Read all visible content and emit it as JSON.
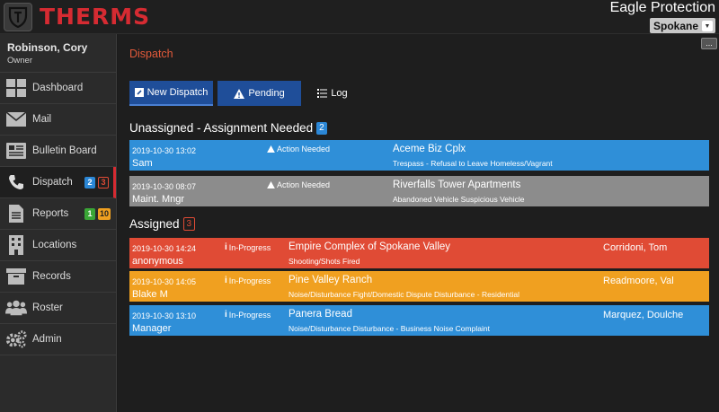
{
  "app": {
    "logo_text": "THERMS",
    "org_name": "Eagle Protection",
    "location": "Spokane"
  },
  "user": {
    "name": "Robinson, Cory",
    "role": "Owner"
  },
  "sidebar": {
    "items": [
      {
        "label": "Dashboard",
        "icon": "dashboard-icon"
      },
      {
        "label": "Mail",
        "icon": "mail-icon"
      },
      {
        "label": "Bulletin Board",
        "icon": "bulletin-board-icon"
      },
      {
        "label": "Dispatch",
        "icon": "phone-icon",
        "badges": [
          "2",
          "3"
        ]
      },
      {
        "label": "Reports",
        "icon": "document-icon",
        "badges": [
          "1",
          "10"
        ]
      },
      {
        "label": "Locations",
        "icon": "building-icon"
      },
      {
        "label": "Records",
        "icon": "archive-icon"
      },
      {
        "label": "Roster",
        "icon": "people-icon"
      },
      {
        "label": "Admin",
        "icon": "gears-icon"
      }
    ]
  },
  "main": {
    "title": "Dispatch",
    "more_label": "...",
    "buttons": {
      "new_dispatch": "New Dispatch",
      "pending": "Pending",
      "log": "Log"
    },
    "unassigned": {
      "title": "Unassigned - Assignment Needed",
      "count": "2",
      "rows": [
        {
          "datetime": "2019-10-30   13:02",
          "caller": "Sam",
          "status": "Action Needed",
          "place": "Aceme Biz Cplx",
          "tags": "Trespass - Refusal to Leave  Homeless/Vagrant",
          "color": "#2f8fd8"
        },
        {
          "datetime": "2019-10-30   08:07",
          "caller": "Maint. Mngr",
          "status": "Action Needed",
          "place": "Riverfalls Tower Apartments",
          "tags": "Abandoned Vehicle  Suspicious Vehicle",
          "color": "#8c8c8c"
        }
      ]
    },
    "assigned": {
      "title": "Assigned",
      "count": "3",
      "rows": [
        {
          "datetime": "2019-10-30   14:24",
          "caller": "anonymous",
          "status": "In-Progress",
          "place": "Empire Complex of Spokane Valley",
          "tags": "Shooting/Shots Fired",
          "officer": "Corridoni, Tom",
          "color": "#e04b35"
        },
        {
          "datetime": "2019-10-30   14:05",
          "caller": "Blake M",
          "status": "In-Progress",
          "place": "Pine Valley Ranch",
          "tags": "Noise/Disturbance  Fight/Domestic Dispute  Disturbance - Residential",
          "officer": "Readmoore, Val",
          "color": "#f0a020"
        },
        {
          "datetime": "2019-10-30   13:10",
          "caller": "Manager",
          "status": "In-Progress",
          "place": "Panera Bread",
          "tags": "Noise/Disturbance  Disturbance - Business  Noise Complaint",
          "officer": "Marquez, Doulche",
          "color": "#2f8fd8"
        }
      ]
    }
  }
}
